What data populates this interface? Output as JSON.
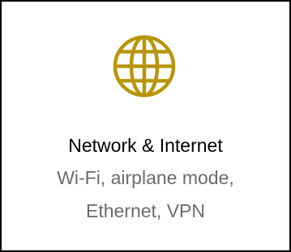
{
  "tile": {
    "icon": "globe-icon",
    "accent_color": "#b8960c",
    "title": "Network & Internet",
    "description_line1": "Wi-Fi, airplane mode,",
    "description_line2": "Ethernet, VPN"
  }
}
